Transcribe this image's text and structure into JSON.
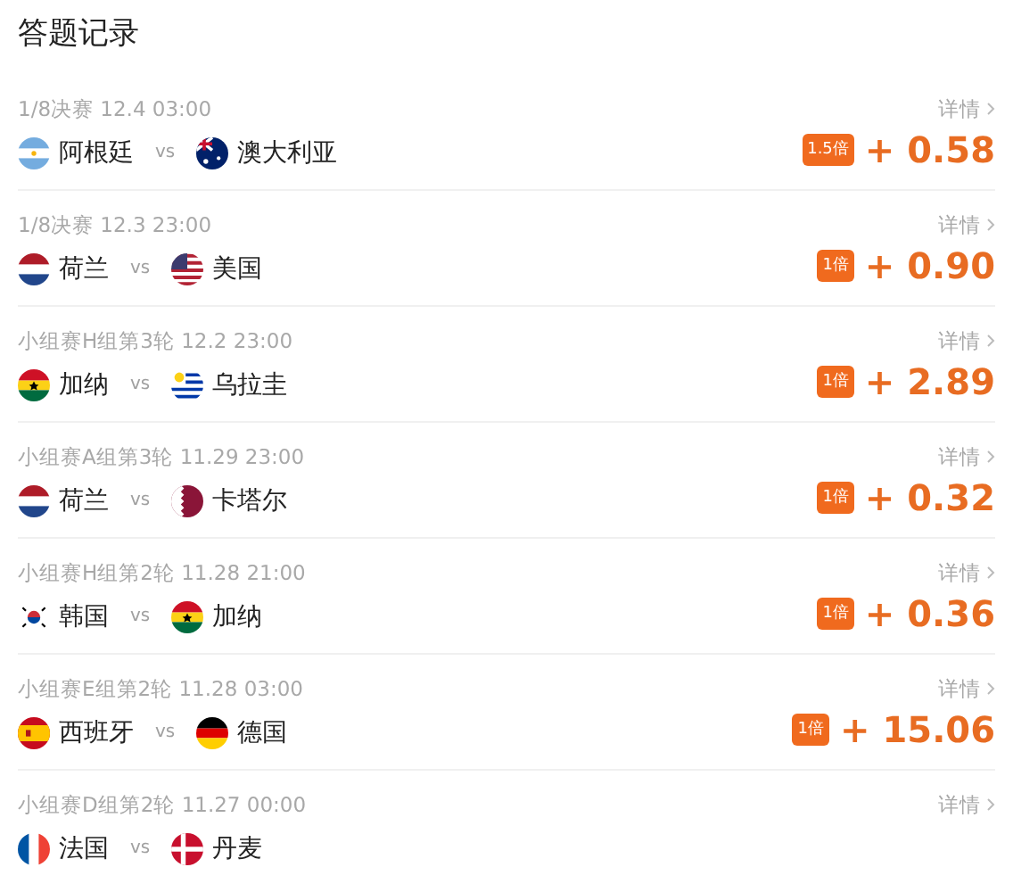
{
  "title": "答题记录",
  "records": [
    {
      "match": "1/8决赛 12.4 03:00",
      "home": {
        "name": "阿根廷",
        "kind": "argentina"
      },
      "vs": "vs",
      "away": {
        "name": "澳大利亚",
        "kind": "australia"
      },
      "detail": "详情",
      "multiplier": "1.5倍",
      "score": "+ 0.58"
    },
    {
      "match": "1/8决赛 12.3 23:00",
      "home": {
        "name": "荷兰",
        "kind": "netherlands"
      },
      "vs": "vs",
      "away": {
        "name": "美国",
        "kind": "usa"
      },
      "detail": "详情",
      "multiplier": "1倍",
      "score": "+ 0.90"
    },
    {
      "match": "小组赛H组第3轮 12.2 23:00",
      "home": {
        "name": "加纳",
        "kind": "ghana"
      },
      "vs": "vs",
      "away": {
        "name": "乌拉圭",
        "kind": "uruguay"
      },
      "detail": "详情",
      "multiplier": "1倍",
      "score": "+ 2.89"
    },
    {
      "match": "小组赛A组第3轮 11.29 23:00",
      "home": {
        "name": "荷兰",
        "kind": "netherlands"
      },
      "vs": "vs",
      "away": {
        "name": "卡塔尔",
        "kind": "qatar"
      },
      "detail": "详情",
      "multiplier": "1倍",
      "score": "+ 0.32"
    },
    {
      "match": "小组赛H组第2轮 11.28 21:00",
      "home": {
        "name": "韩国",
        "kind": "korea"
      },
      "vs": "vs",
      "away": {
        "name": "加纳",
        "kind": "ghana"
      },
      "detail": "详情",
      "multiplier": "1倍",
      "score": "+ 0.36"
    },
    {
      "match": "小组赛E组第2轮 11.28 03:00",
      "home": {
        "name": "西班牙",
        "kind": "spain"
      },
      "vs": "vs",
      "away": {
        "name": "德国",
        "kind": "germany"
      },
      "detail": "详情",
      "multiplier": "1倍",
      "score": "+ 15.06"
    },
    {
      "match": "小组赛D组第2轮 11.27 00:00",
      "home": {
        "name": "法国",
        "kind": "france"
      },
      "vs": "vs",
      "away": {
        "name": "丹麦",
        "kind": "denmark"
      },
      "detail": "详情"
    }
  ]
}
